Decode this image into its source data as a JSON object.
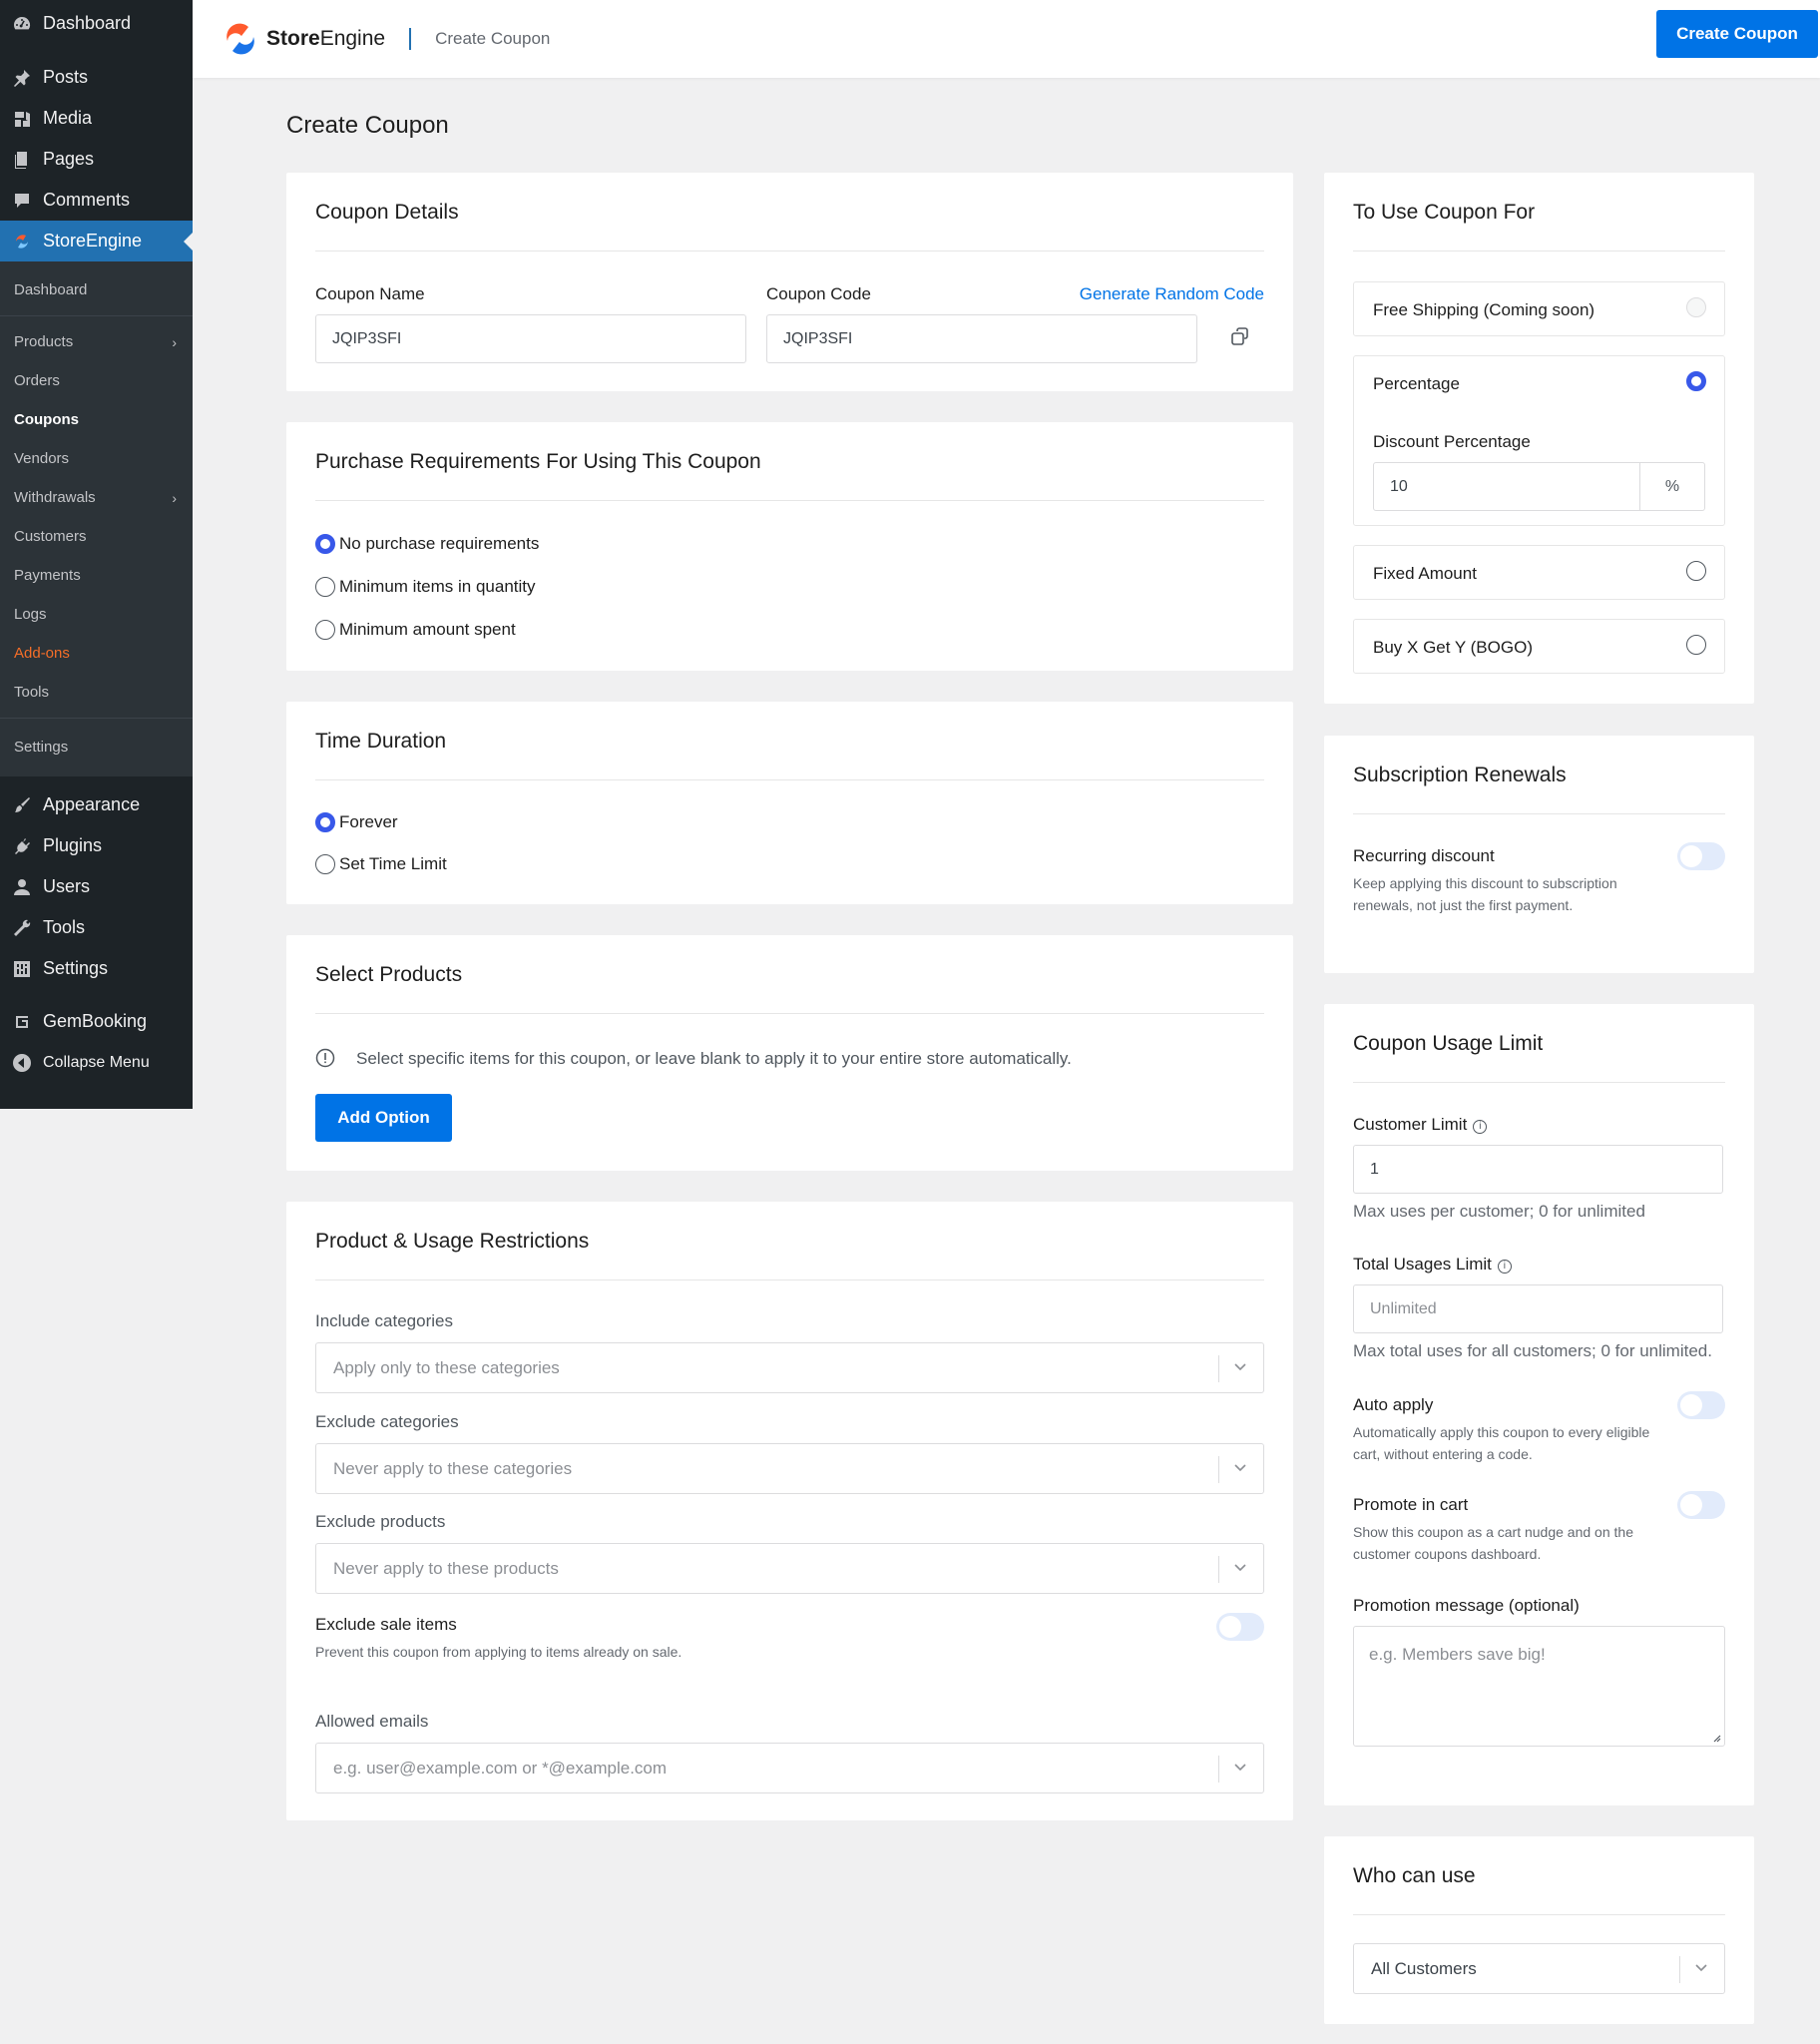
{
  "wp_menu": {
    "top": [
      {
        "label": "Dashboard",
        "icon": "dashboard-icon"
      },
      {
        "label": "Posts",
        "icon": "pin-icon"
      },
      {
        "label": "Media",
        "icon": "media-icon"
      },
      {
        "label": "Pages",
        "icon": "pages-icon"
      },
      {
        "label": "Comments",
        "icon": "comments-icon"
      },
      {
        "label": "StoreEngine",
        "icon": "storeengine-icon"
      }
    ],
    "submenu": [
      {
        "label": "Dashboard"
      },
      {
        "label": "Products",
        "has_children": true
      },
      {
        "label": "Orders"
      },
      {
        "label": "Coupons",
        "current": true
      },
      {
        "label": "Vendors"
      },
      {
        "label": "Withdrawals",
        "has_children": true
      },
      {
        "label": "Customers"
      },
      {
        "label": "Payments"
      },
      {
        "label": "Logs"
      },
      {
        "label": "Add-ons",
        "highlight": "#f56e28"
      },
      {
        "label": "Tools"
      },
      {
        "label": "Settings"
      }
    ],
    "bottom": [
      {
        "label": "Appearance",
        "icon": "brush-icon"
      },
      {
        "label": "Plugins",
        "icon": "plugin-icon"
      },
      {
        "label": "Users",
        "icon": "user-icon"
      },
      {
        "label": "Tools",
        "icon": "wrench-icon"
      },
      {
        "label": "Settings",
        "icon": "settings-icon"
      },
      {
        "label": "GemBooking",
        "icon": "gem-icon"
      },
      {
        "label": "Collapse Menu",
        "icon": "collapse-icon"
      }
    ]
  },
  "header": {
    "brand_bold": "Store",
    "brand_rest": "Engine",
    "breadcrumb": "Create Coupon",
    "cta_label": "Create Coupon",
    "accent": "#0073e6"
  },
  "page_title": "Create Coupon",
  "coupon_details": {
    "title": "Coupon Details",
    "name_label": "Coupon Name",
    "name_value": "JQIP3SFI",
    "code_label": "Coupon Code",
    "generate_label": "Generate Random Code",
    "code_value": "JQIP3SFI"
  },
  "purchase_requirements": {
    "title": "Purchase Requirements For Using This Coupon",
    "options": [
      "No purchase requirements",
      "Minimum items in quantity",
      "Minimum amount spent"
    ],
    "selected": "No purchase requirements"
  },
  "time_duration": {
    "title": "Time Duration",
    "options": [
      "Forever",
      "Set Time Limit"
    ],
    "selected": "Forever"
  },
  "select_products": {
    "title": "Select Products",
    "info": "Select specific items for this coupon, or leave blank to apply it to your entire store automatically.",
    "button": "Add Option"
  },
  "restrictions": {
    "title": "Product & Usage Restrictions",
    "include_label": "Include categories",
    "include_placeholder": "Apply only to these categories",
    "exclude_label": "Exclude categories",
    "exclude_placeholder": "Never apply to these categories",
    "exclude_products_label": "Exclude products",
    "exclude_products_placeholder": "Never apply to these products",
    "sale_label": "Exclude sale items",
    "sale_help": "Prevent this coupon from applying to items already on sale.",
    "emails_label": "Allowed emails",
    "emails_placeholder": "e.g. user@example.com or *@example.com"
  },
  "use_for": {
    "title": "To Use Coupon For",
    "free_shipping": "Free Shipping (Coming soon)",
    "percentage": "Percentage",
    "discount_label": "Discount Percentage",
    "discount_value": "10",
    "discount_unit": "%",
    "fixed": "Fixed Amount",
    "bogo": "Buy X Get Y (BOGO)"
  },
  "subscription": {
    "title": "Subscription Renewals",
    "recurring_label": "Recurring discount",
    "recurring_help": "Keep applying this discount to subscription renewals, not just the first payment."
  },
  "usage_limit": {
    "title": "Coupon Usage Limit",
    "customer_label": "Customer Limit",
    "customer_value": "1",
    "customer_note": "Max uses per customer; 0 for unlimited",
    "total_label": "Total Usages Limit",
    "total_placeholder": "Unlimited",
    "total_note": "Max total uses for all customers; 0 for unlimited.",
    "auto_label": "Auto apply",
    "auto_help": "Automatically apply this coupon to every eligible cart, without entering a code.",
    "promote_label": "Promote in cart",
    "promote_help": "Show this coupon as a cart nudge and on the customer coupons dashboard.",
    "promo_msg_label": "Promotion message (optional)",
    "promo_msg_placeholder": "e.g. Members save big!"
  },
  "who": {
    "title": "Who can use",
    "value": "All Customers"
  }
}
